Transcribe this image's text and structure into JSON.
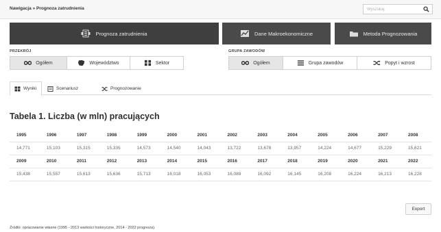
{
  "breadcrumb": "Nawigacja » Prognoza zatrudnienia",
  "search": {
    "placeholder": "Wyszukaj"
  },
  "nav": [
    {
      "label": "Prognoza zatrudnienia",
      "icon": "forecast-icon"
    },
    {
      "label": "Dane Makroekonomiczne",
      "icon": "macro-chart-icon"
    },
    {
      "label": "Metoda Prognozowania",
      "icon": "folder-icon"
    }
  ],
  "groups": {
    "przekroj": {
      "label": "PRZEKRÓJ",
      "buttons": [
        {
          "label": "Ogółem",
          "icon": "infinity-icon",
          "active": true
        },
        {
          "label": "Województwo",
          "icon": "region-map-icon",
          "active": false
        },
        {
          "label": "Sektor",
          "icon": "grid-icon",
          "active": false
        }
      ]
    },
    "grupa": {
      "label": "GRUPA ZAWODÓW",
      "buttons": [
        {
          "label": "Ogółem",
          "icon": "infinity-icon",
          "active": true
        },
        {
          "label": "Grupa zawodów",
          "icon": "list-icon",
          "active": false
        },
        {
          "label": "Popyt i wzrost",
          "icon": "shuffle-icon",
          "active": false
        }
      ]
    }
  },
  "tabs": [
    {
      "label": "Wyniki",
      "icon": "grid-icon",
      "active": true
    },
    {
      "label": "Scenariusz",
      "icon": "document-icon",
      "active": false
    },
    {
      "label": "Prognozowanie",
      "icon": "shuffle-icon",
      "active": false
    }
  ],
  "table": {
    "title": "Tabela 1. Liczba (w mln) pracujących",
    "rows": [
      {
        "years": [
          "1995",
          "1996",
          "1997",
          "1998",
          "1999",
          "2000",
          "2001",
          "2002",
          "2003",
          "2004",
          "2005",
          "2006",
          "2007",
          "2008"
        ],
        "values": [
          "14,771",
          "15,103",
          "15,315",
          "15,335",
          "14,573",
          "14,540",
          "14,043",
          "13,722",
          "13,678",
          "13,957",
          "14,224",
          "14,677",
          "15,229",
          "15,621"
        ]
      },
      {
        "years": [
          "2009",
          "2010",
          "2011",
          "2012",
          "2013",
          "2014",
          "2015",
          "2016",
          "2017",
          "2018",
          "2019",
          "2020",
          "2021",
          "2022"
        ],
        "values": [
          "15,438",
          "15,557",
          "15,613",
          "15,636",
          "15,713",
          "16,018",
          "16,053",
          "16,089",
          "16,092",
          "16,145",
          "16,208",
          "16,224",
          "16,213",
          "16,228"
        ]
      }
    ]
  },
  "export_label": "Export",
  "source_note": "Źródło: opracowanie własne (1995 - 2013 wartości historyczne, 2014 - 2022 prognoza)."
}
